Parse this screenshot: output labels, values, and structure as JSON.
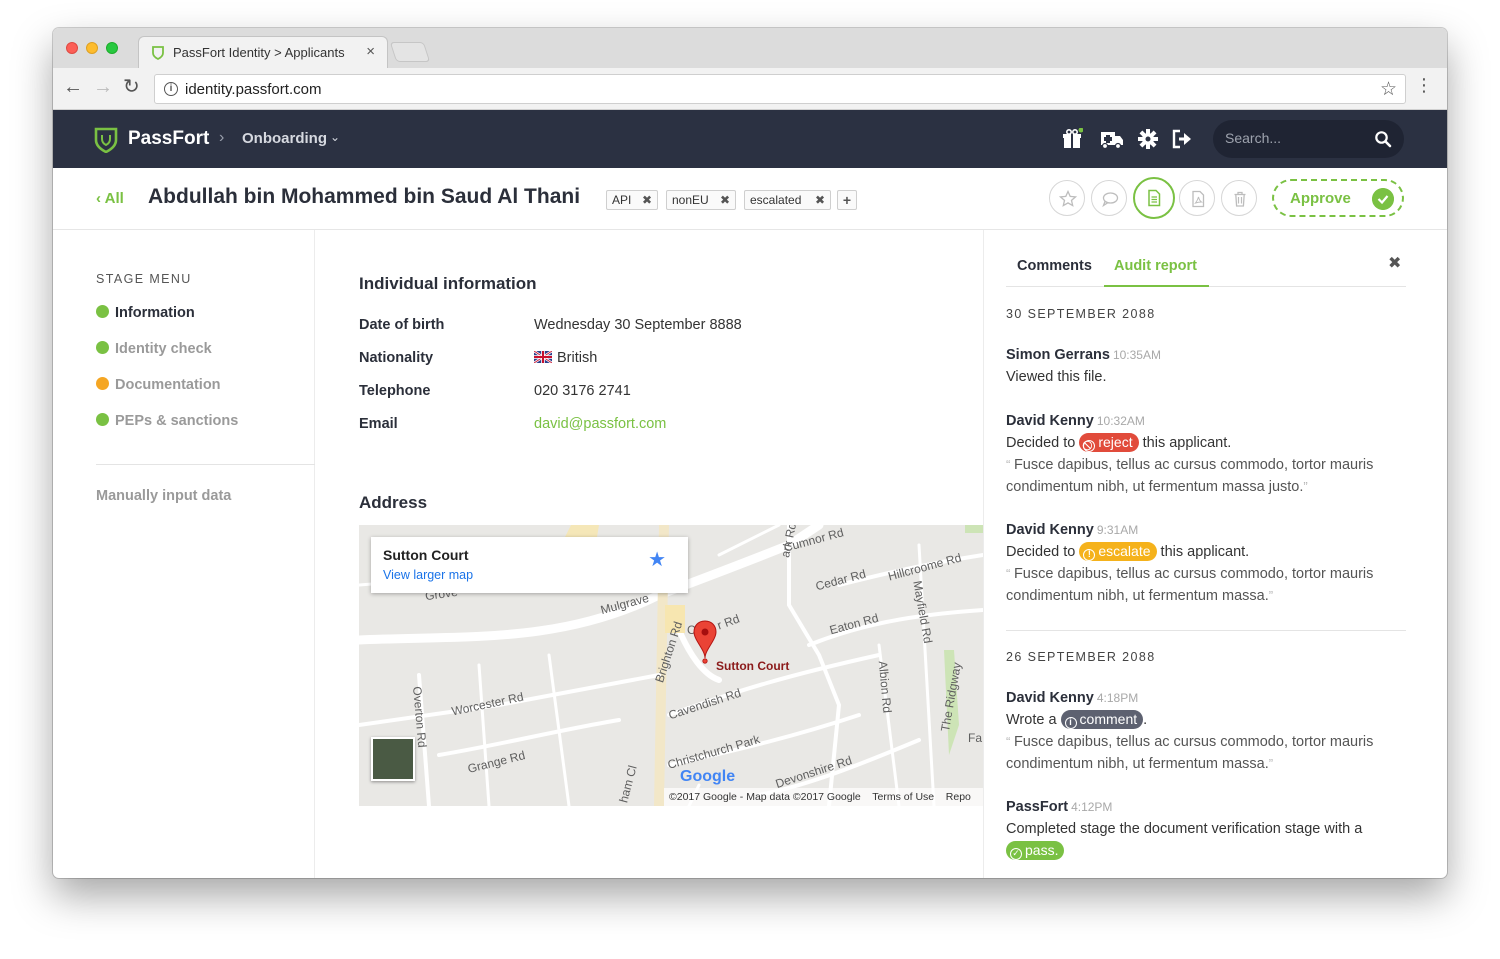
{
  "browser": {
    "tab_title": "PassFort Identity > Applicants",
    "url": "identity.passfort.com"
  },
  "header": {
    "brand": "PassFort",
    "breadcrumb": "Onboarding",
    "search_placeholder": "Search...",
    "icons": [
      "gift-icon",
      "ambulance-icon",
      "gear-icon",
      "logout-icon",
      "search-icon"
    ]
  },
  "titlebar": {
    "back_label": "‹ All",
    "name": "Abdullah bin Mohammed bin Saud Al Thani",
    "tags": [
      "API",
      "nonEU",
      "escalated"
    ],
    "add_tag": "+",
    "approve_label": "Approve"
  },
  "stage_menu": {
    "title": "STAGE MENU",
    "items": [
      {
        "label": "Information",
        "status": "ok"
      },
      {
        "label": "Identity check",
        "status": "ok"
      },
      {
        "label": "Documentation",
        "status": "warn"
      },
      {
        "label": "PEPs & sanctions",
        "status": "ok"
      }
    ],
    "manual": "Manually input data"
  },
  "individual": {
    "title": "Individual information",
    "rows": [
      {
        "label": "Date of birth",
        "value": "Wednesday 30 September 8888"
      },
      {
        "label": "Nationality",
        "value": "British"
      },
      {
        "label": "Telephone",
        "value": "020 3176 2741"
      },
      {
        "label": "Email",
        "value": "david@passfort.com"
      }
    ]
  },
  "address": {
    "title": "Address",
    "map_card_title": "Sutton Court",
    "map_card_link": "View larger map",
    "pin_label": "Sutton Court",
    "streets": [
      "Cumnor Rd",
      "Cedar Rd",
      "Hillcroome Rd",
      "Grove",
      "Mulgrave",
      "Eaton Rd",
      "Mayfield Rd",
      "Brighton Rd",
      "Albion Rd",
      "The Ridgway",
      "Overton Rd",
      "Worcester Rd",
      "Cavendish Rd",
      "Christchurch Park",
      "Grange Rd",
      "Devonshire Rd",
      "ark Rd",
      "C",
      "r Rd",
      "ham Cl",
      "Fa"
    ],
    "google": "Google",
    "footer_data": "©2017 Google - Map data ©2017 Google",
    "footer_terms": "Terms of Use",
    "footer_report": "Repo"
  },
  "panel": {
    "tabs": [
      "Comments",
      "Audit report"
    ],
    "groups": [
      {
        "date": "30 SEPTEMBER 2088",
        "entries": [
          {
            "author": "Simon Gerrans",
            "time": "10:35AM",
            "text": "Viewed this file."
          },
          {
            "author": "David Kenny",
            "time": "10:32AM",
            "pre": "Decided to",
            "pill": "reject",
            "post": "this applicant.",
            "quote": "Fusce dapibus, tellus ac cursus commodo, tortor mauris condimentum nibh, ut fermentum massa justo."
          },
          {
            "author": "David Kenny",
            "time": "9:31AM",
            "pre": "Decided to",
            "pill": "escalate",
            "post": "this applicant.",
            "quote": "Fusce dapibus, tellus ac cursus commodo, tortor mauris condimentum nibh, ut fermentum massa."
          }
        ]
      },
      {
        "date": "26 SEPTEMBER 2088",
        "entries": [
          {
            "author": "David Kenny",
            "time": "4:18PM",
            "pre": "Wrote a",
            "pill": "comment",
            "post": ".",
            "quote": "Fusce dapibus, tellus ac cursus commodo, tortor mauris condimentum nibh, ut fermentum massa."
          },
          {
            "author": "PassFort",
            "time": "4:12PM",
            "pre": "Completed stage the document verification stage with a",
            "pill": "pass."
          }
        ]
      }
    ]
  },
  "colors": {
    "accent": "#7ac143",
    "header_bg": "#2b3142",
    "reject": "#e14b3b",
    "escalate": "#f5b21b",
    "comment": "#5d6170",
    "warn": "#f5a623"
  }
}
